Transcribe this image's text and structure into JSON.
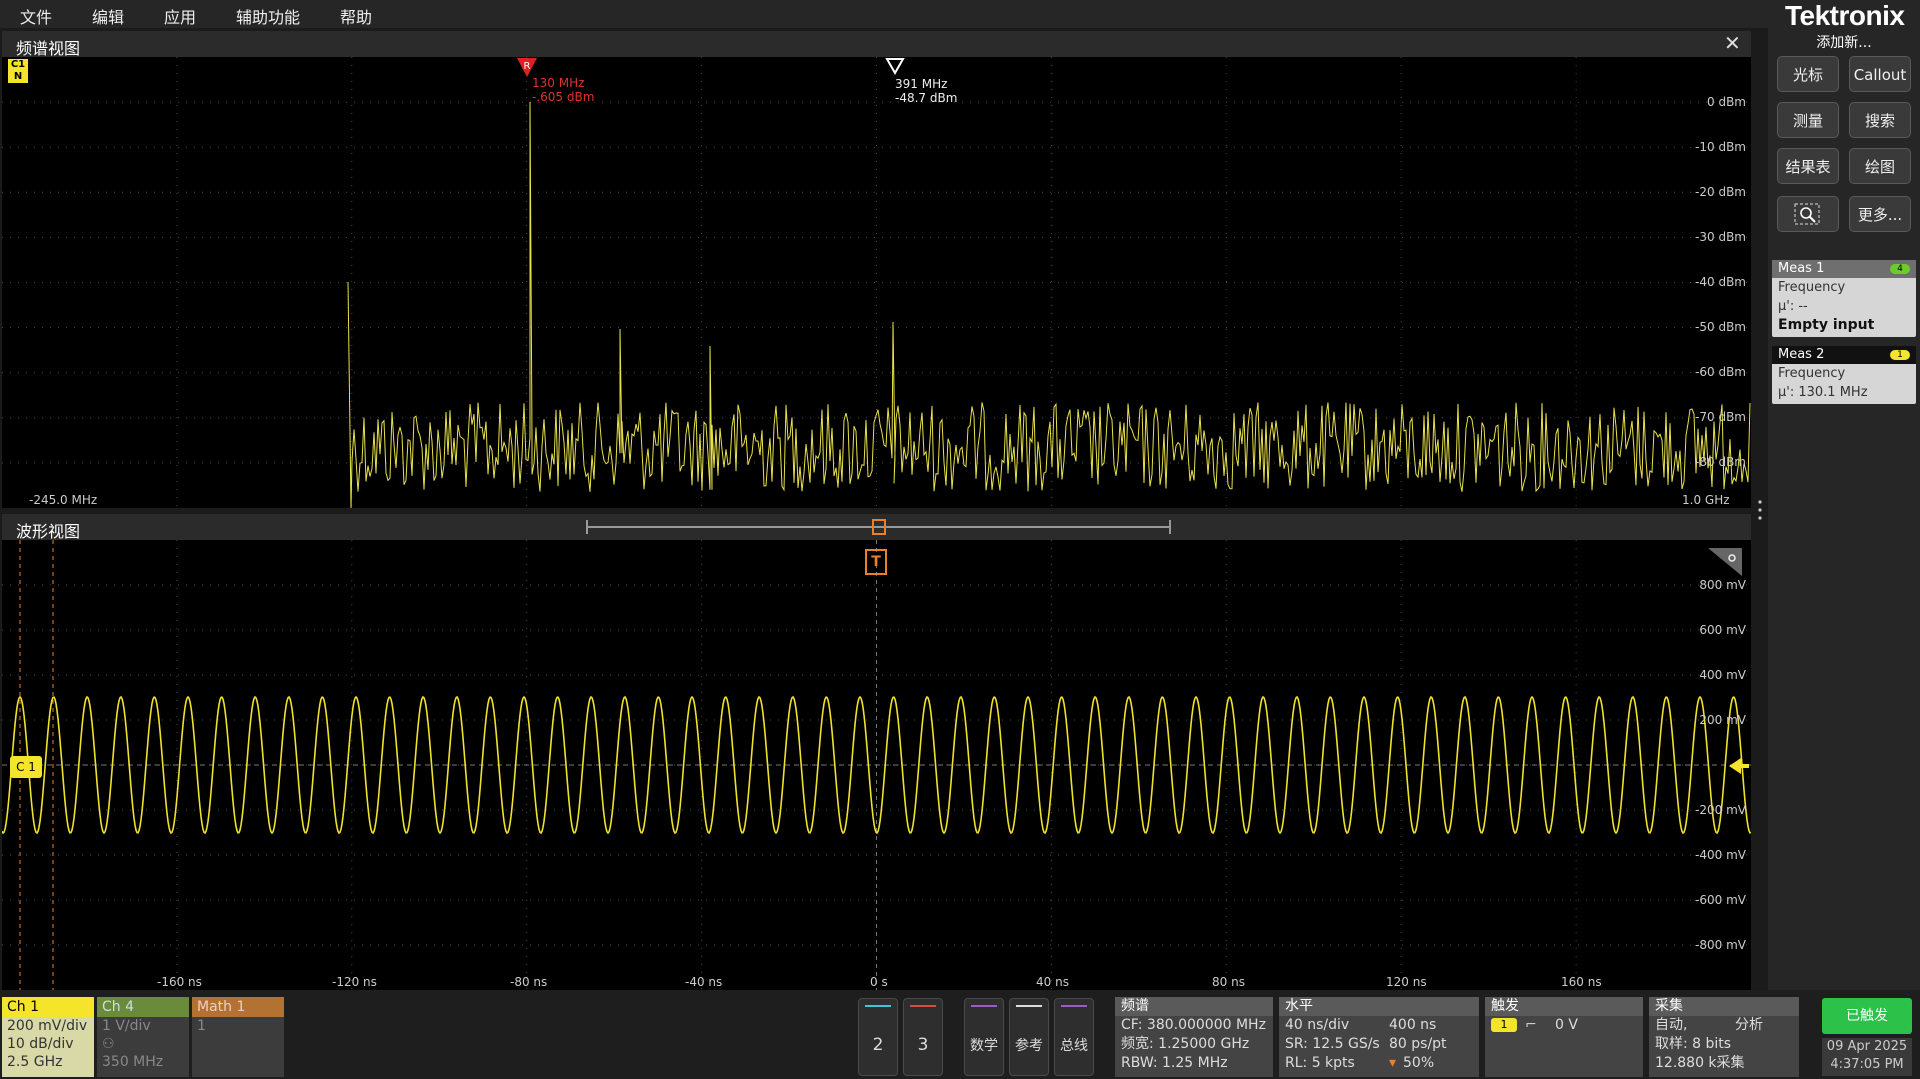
{
  "menu": [
    "文件",
    "编辑",
    "应用",
    "辅助功能",
    "帮助"
  ],
  "brand": "Tektronix",
  "right_panel": {
    "add_new": "添加新...",
    "buttons": [
      "光标",
      "Callout",
      "测量",
      "搜索",
      "结果表",
      "绘图",
      "更多..."
    ],
    "zoom_icon": "zoom-box-icon"
  },
  "measurements": [
    {
      "title": "Meas 1",
      "badge": "4",
      "badge_color": "#6ccc2c",
      "type": "Frequency",
      "mu": "μ': --",
      "note": "Empty input"
    },
    {
      "title": "Meas 2",
      "badge": "1",
      "badge_color": "#f5e52a",
      "type": "Frequency",
      "mu": "μ': 130.1 MHz",
      "note": ""
    }
  ],
  "spectrum_view": {
    "title": "频谱视图",
    "channel_tag": "C1",
    "channel_sub": "N",
    "marker_ref": {
      "letter": "R",
      "freq": "130 MHz",
      "level": "-.605 dBm"
    },
    "marker_2": {
      "freq": "391 MHz",
      "level": "-48.7 dBm"
    },
    "start_freq": "-245.0 MHz",
    "stop_freq": "1.0 GHz",
    "y_labels": [
      "0 dBm",
      "-10 dBm",
      "-20 dBm",
      "-30 dBm",
      "-40 dBm",
      "-50 dBm",
      "-60 dBm",
      "-70 dBm",
      "-80 dBm"
    ],
    "trace_color": "#e8e24a"
  },
  "waveform_view": {
    "title": "波形视图",
    "channel_tag": "C 1",
    "trigger_tag": "T",
    "x_labels": [
      "-160 ns",
      "-120 ns",
      "-80 ns",
      "-40 ns",
      "0 s",
      "40 ns",
      "80 ns",
      "120 ns",
      "160 ns"
    ],
    "y_labels": [
      "800 mV",
      "600 mV",
      "400 mV",
      "200 mV",
      "-200 mV",
      "-400 mV",
      "-600 mV",
      "-800 mV"
    ],
    "trace_color": "#f0e22a"
  },
  "channels": [
    {
      "name": "Ch 1",
      "lines": [
        "200 mV/div",
        "10 dB/div",
        "2.5 GHz"
      ],
      "color": "#f5e52a"
    },
    {
      "name": "Ch 4",
      "lines": [
        "1 V/div",
        "",
        "350 MHz"
      ],
      "color": "#6a8c3a"
    },
    {
      "name": "Math 1",
      "lines": [
        "1"
      ],
      "color": "#b37232"
    }
  ],
  "bottom_buttons": [
    "2",
    "3",
    "数学",
    "参考",
    "总线"
  ],
  "spectrum_info": {
    "title": "频谱",
    "lines": [
      "CF: 380.000000 MHz",
      "频宽: 1.25000 GHz",
      "RBW: 1.25 MHz"
    ]
  },
  "horizontal": {
    "title": "水平",
    "rows": [
      [
        "40 ns/div",
        "400 ns"
      ],
      [
        "SR: 12.5 GS/s",
        "80 ps/pt"
      ],
      [
        "RL: 5 kpts",
        "50%"
      ]
    ]
  },
  "trigger": {
    "title": "触发",
    "channel": "1",
    "level": "0 V"
  },
  "acquisition": {
    "title": "采集",
    "rows": [
      [
        "自动,",
        "分析"
      ],
      [
        "取样: 8 bits",
        ""
      ],
      [
        "12.880 k采集",
        ""
      ]
    ]
  },
  "status": {
    "triggered": "已触发",
    "date": "09 Apr 2025",
    "time": "4:37:05 PM"
  }
}
